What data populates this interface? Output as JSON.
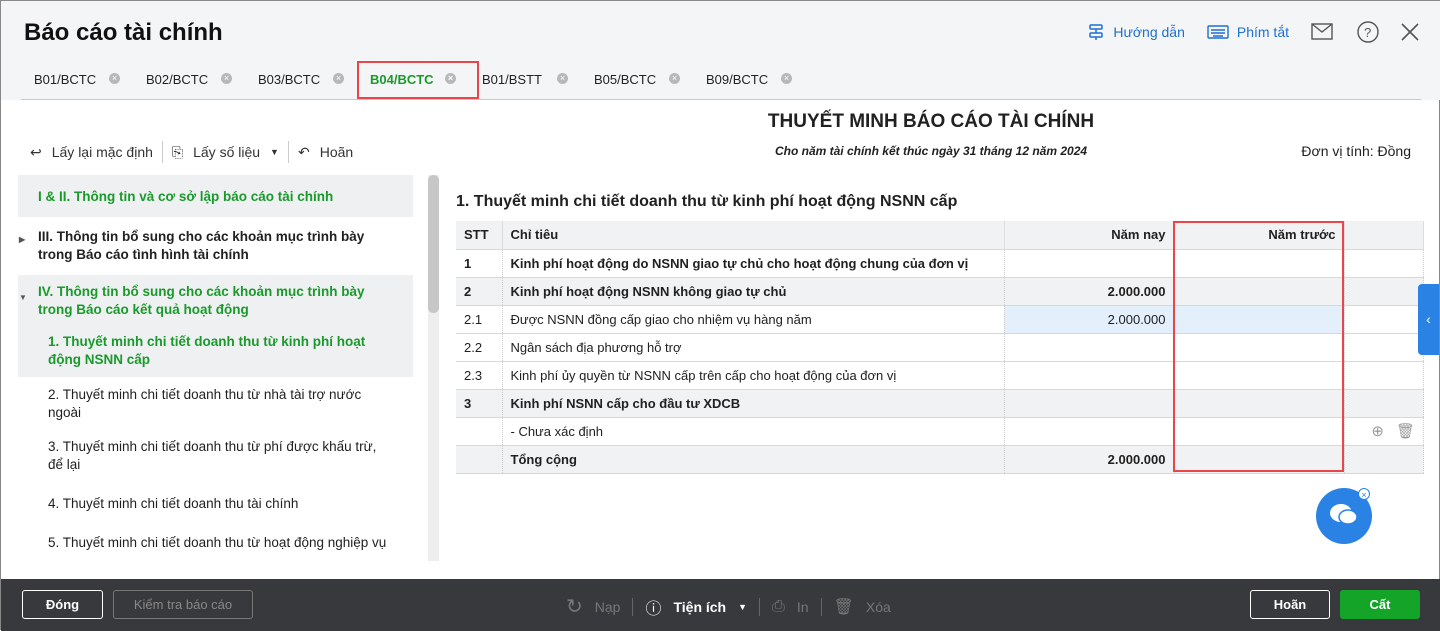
{
  "header": {
    "title": "Báo cáo tài chính",
    "guide": "Hướng dẫn",
    "shortcuts": "Phím tắt"
  },
  "tabs": [
    "B01/BCTC",
    "B02/BCTC",
    "B03/BCTC",
    "B04/BCTC",
    "B01/BSTT",
    "B05/BCTC",
    "B09/BCTC"
  ],
  "active_tab": "B04/BCTC",
  "toolbar": {
    "reset": "Lấy lại mặc định",
    "get_data": "Lấy số liệu",
    "undo": "Hoãn"
  },
  "report": {
    "title": "THUYẾT MINH BÁO CÁO TÀI CHÍNH",
    "subtitle": "Cho năm tài chính kết thúc ngày 31 tháng 12 năm 2024",
    "unit": "Đơn vị tính: Đồng"
  },
  "sidebar": [
    "I & II. Thông tin và cơ sở lập báo cáo tài chính",
    "III. Thông tin bổ sung cho các khoản mục trình bày trong Báo cáo tình hình tài chính",
    "IV. Thông tin bổ sung cho các khoản mục trình bày trong Báo cáo kết quả hoạt động",
    "1. Thuyết minh chi tiết doanh thu từ kinh phí hoạt động NSNN cấp",
    "2. Thuyết minh chi tiết doanh thu từ nhà tài trợ nước ngoài",
    "3. Thuyết minh chi tiết doanh thu từ phí được khấu trừ, để lại",
    "4. Thuyết minh chi tiết doanh thu tài chính",
    "5. Thuyết minh chi tiết doanh thu từ hoạt động nghiệp vụ"
  ],
  "section_title": "1. Thuyết minh chi tiết doanh thu từ kinh phí hoạt động NSNN cấp",
  "table": {
    "headers": [
      "STT",
      "Chỉ tiêu",
      "Năm nay",
      "Năm trước"
    ],
    "rows": [
      [
        "1",
        "Kinh phí hoạt động do NSNN giao tự chủ cho hoạt động chung của đơn vị",
        "",
        ""
      ],
      [
        "2",
        "Kinh phí hoạt động NSNN không giao tự chủ",
        "2.000.000",
        ""
      ],
      [
        "2.1",
        "Được NSNN đồng cấp giao cho nhiệm vụ hàng năm",
        "2.000.000",
        ""
      ],
      [
        "2.2",
        "Ngân sách địa phương hỗ trợ",
        "",
        ""
      ],
      [
        "2.3",
        "Kinh phí ủy quyền từ NSNN cấp trên cấp cho hoạt động của đơn vị",
        "",
        ""
      ],
      [
        "3",
        "Kinh phí NSNN cấp cho đầu tư XDCB",
        "",
        ""
      ],
      [
        "",
        "- Chưa xác định",
        "",
        ""
      ],
      [
        "",
        "Tổng cộng",
        "2.000.000",
        ""
      ]
    ]
  },
  "footer": {
    "close": "Đóng",
    "check": "Kiểm tra báo cáo",
    "load": "Nạp",
    "utilities": "Tiện ích",
    "print": "In",
    "delete": "Xóa",
    "cancel": "Hoãn",
    "save": "Cất"
  }
}
